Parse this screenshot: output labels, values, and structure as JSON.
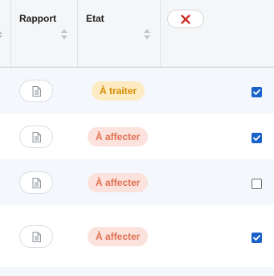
{
  "table": {
    "columns": [
      {
        "label": "Rapport",
        "sortable": true
      },
      {
        "label": "Etat",
        "sortable": true
      }
    ],
    "clear_button": {
      "icon": "clear-filter-icon",
      "color": "#d9342b"
    },
    "rows": [
      {
        "report_icon": "document-icon",
        "status": "À traiter",
        "status_type": "traiter",
        "selected": true
      },
      {
        "report_icon": "document-icon",
        "status": "À affecter",
        "status_type": "affecter",
        "selected": true
      },
      {
        "report_icon": "document-icon",
        "status": "À affecter",
        "status_type": "affecter",
        "selected": false
      },
      {
        "report_icon": "document-icon",
        "status": "À affecter",
        "status_type": "affecter",
        "selected": true
      }
    ]
  },
  "colors": {
    "checkbox_checked": "#1a62c9",
    "badge_traiter_bg": "#fdecc3",
    "badge_traiter_text": "#d68a00",
    "badge_affecter_bg": "#fbe2dc",
    "badge_affecter_text": "#e07050"
  }
}
